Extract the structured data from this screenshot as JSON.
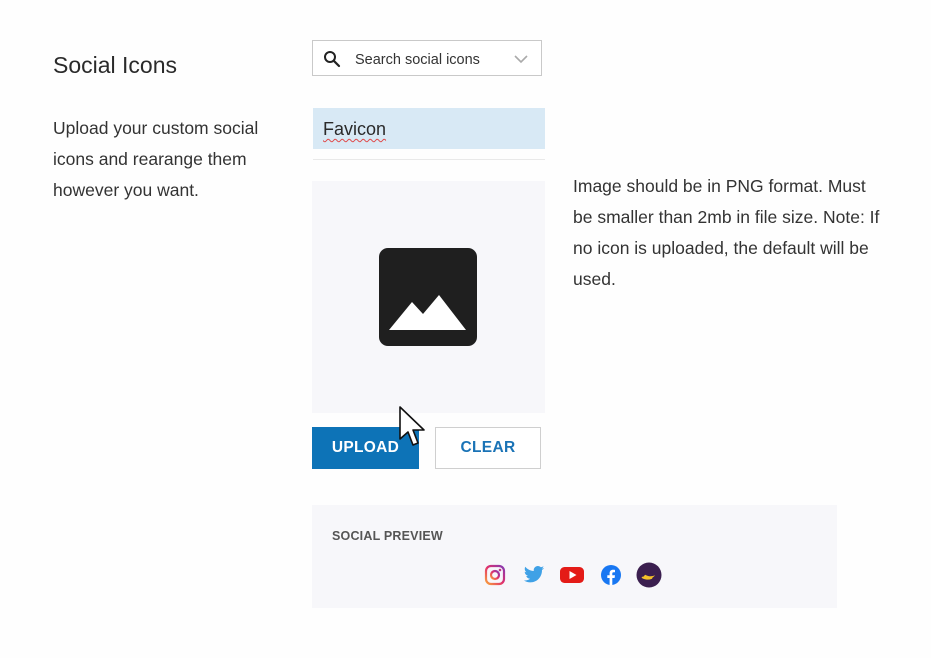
{
  "section": {
    "title": "Social Icons",
    "description": "Upload your custom social icons and rearange them however you want."
  },
  "search": {
    "placeholder": "Search social icons"
  },
  "list": {
    "selected_item": "Favicon"
  },
  "upload": {
    "note": "Image should be in PNG format. Must be smaller than 2mb in file size. Note: If no icon is uploaded, the default will be used.",
    "upload_label": "UPLOAD",
    "clear_label": "CLEAR"
  },
  "social_preview": {
    "label": "SOCIAL PREVIEW",
    "icons": [
      "instagram-icon",
      "twitter-icon",
      "youtube-icon",
      "facebook-icon",
      "custom-moon-icon"
    ]
  },
  "colors": {
    "accent": "#0d73b7",
    "selected_bg": "#d8e9f5",
    "panel_bg": "#f7f7fa"
  }
}
